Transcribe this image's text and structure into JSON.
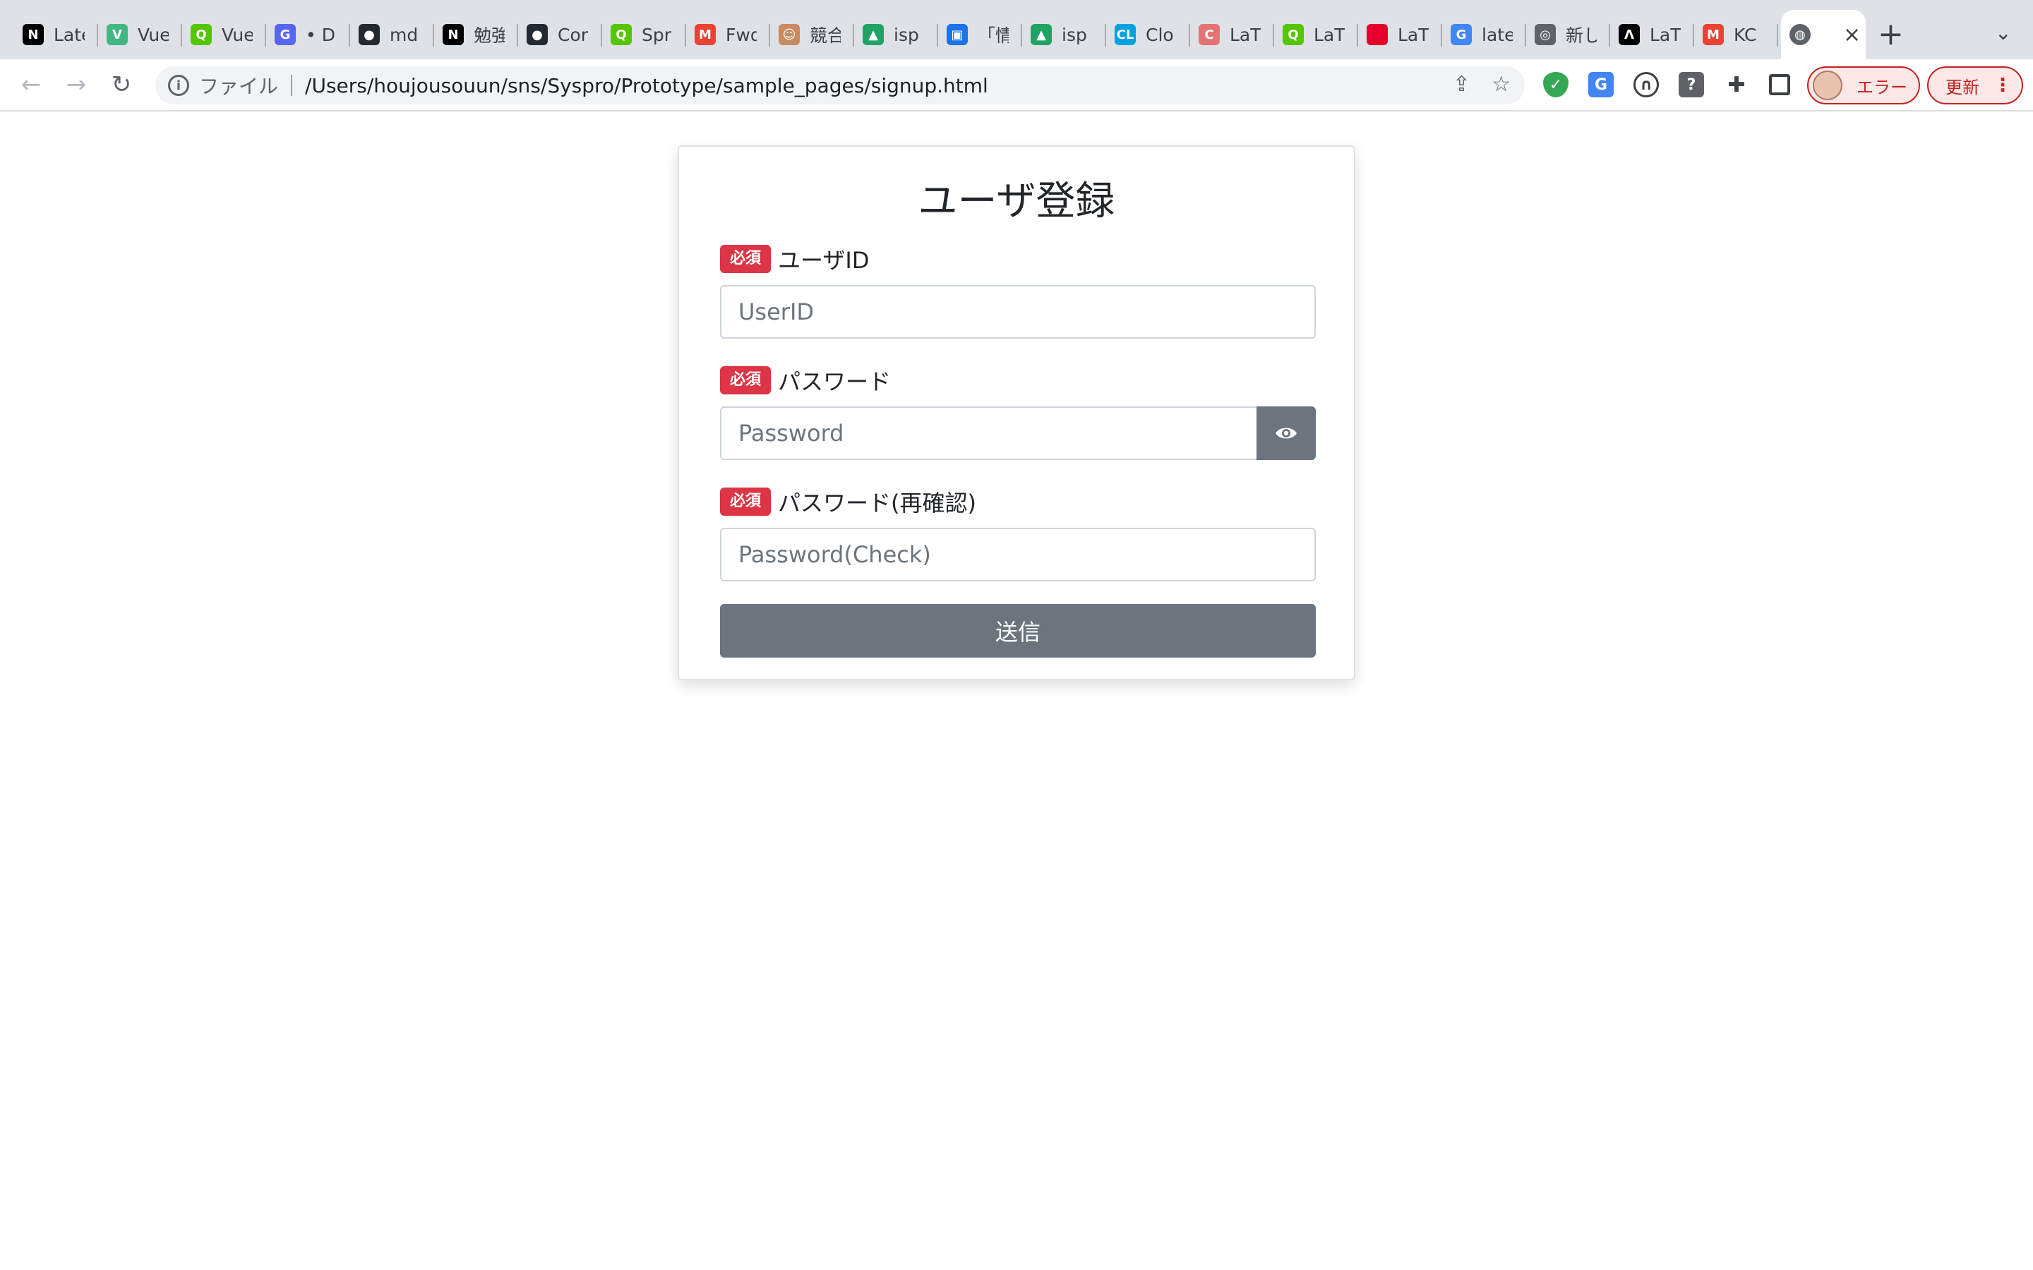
{
  "browser": {
    "tabs": [
      {
        "title": "Late",
        "icon": "notion-icon",
        "color": "#000000",
        "glyph": "N"
      },
      {
        "title": "Vue",
        "icon": "vue-icon",
        "color": "#41b883",
        "glyph": "V"
      },
      {
        "title": "Vue",
        "icon": "qiita-icon",
        "color": "#55c500",
        "glyph": "Q"
      },
      {
        "title": "• Di",
        "icon": "discord-icon",
        "color": "#5865f2",
        "glyph": "G"
      },
      {
        "title": "md",
        "icon": "github-icon",
        "color": "#24292f",
        "glyph": "●"
      },
      {
        "title": "勉強",
        "icon": "notion-icon",
        "color": "#000000",
        "glyph": "N"
      },
      {
        "title": "Cor",
        "icon": "github-icon",
        "color": "#24292f",
        "glyph": "●"
      },
      {
        "title": "Spr",
        "icon": "qiita-icon",
        "color": "#55c500",
        "glyph": "Q"
      },
      {
        "title": "Fwd",
        "icon": "gmail-icon",
        "color": "#ea4335",
        "glyph": "M"
      },
      {
        "title": "競合",
        "icon": "avatar-icon",
        "color": "#c98a5e",
        "glyph": "☺"
      },
      {
        "title": "isp",
        "icon": "drive-icon",
        "color": "#1fa463",
        "glyph": "▲"
      },
      {
        "title": "「情",
        "icon": "contacts-icon",
        "color": "#1a73e8",
        "glyph": "▣"
      },
      {
        "title": "isp",
        "icon": "drive-icon",
        "color": "#1fa463",
        "glyph": "▲"
      },
      {
        "title": "Clo",
        "icon": "cl-icon",
        "color": "#00a1e0",
        "glyph": "CL"
      },
      {
        "title": "LaT",
        "icon": "cite-icon",
        "color": "#e57373",
        "glyph": "C"
      },
      {
        "title": "LaT",
        "icon": "qiita-icon",
        "color": "#55c500",
        "glyph": "Q"
      },
      {
        "title": "LaT",
        "icon": "red-square-icon",
        "color": "#e4002b",
        "glyph": ""
      },
      {
        "title": "late",
        "icon": "google-icon",
        "color": "#4285f4",
        "glyph": "G"
      },
      {
        "title": "新し",
        "icon": "chrome-icon",
        "color": "#5f6368",
        "glyph": "◎"
      },
      {
        "title": "LaT",
        "icon": "overleaf-icon",
        "color": "#000000",
        "glyph": "Λ"
      },
      {
        "title": "KC",
        "icon": "gmail-icon",
        "color": "#ea4335",
        "glyph": "M"
      }
    ],
    "scheme_label": "ファイル",
    "url": "/Users/houjousouun/sns/Syspro/Prototype/sample_pages/signup.html",
    "profile_label": "エラー",
    "update_label": "更新"
  },
  "page": {
    "title": "ユーザ登録",
    "required_badge": "必須",
    "fields": {
      "user_id": {
        "label": "ユーザID",
        "placeholder": "UserID"
      },
      "password": {
        "label": "パスワード",
        "placeholder": "Password"
      },
      "password_check": {
        "label": "パスワード(再確認)",
        "placeholder": "Password(Check)"
      }
    },
    "submit_label": "送信"
  }
}
